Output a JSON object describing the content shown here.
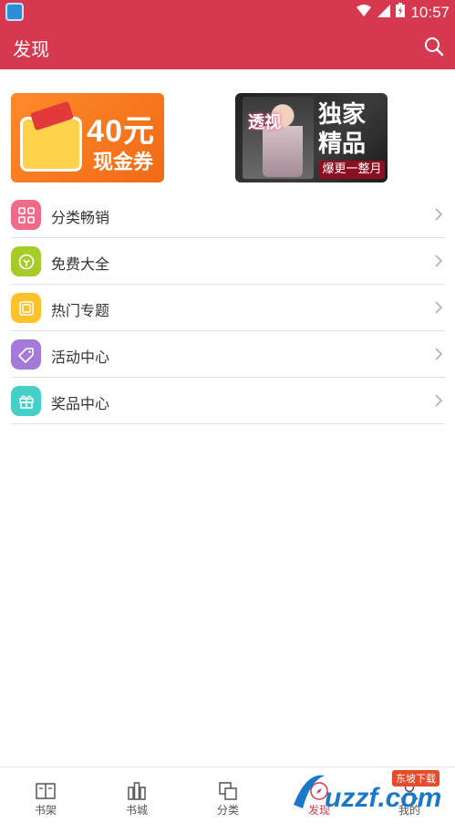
{
  "status_bar": {
    "time": "10:57"
  },
  "app_bar": {
    "title": "发现"
  },
  "banners": {
    "coupon": {
      "amount": "40元",
      "text": "现金券"
    },
    "book": {
      "title": "透视",
      "exclusive": "独家精品",
      "update": "爆更一整月"
    }
  },
  "menu": [
    {
      "label": "分类畅销",
      "color": "#f06b89",
      "icon": "grid-icon"
    },
    {
      "label": "免费大全",
      "color": "#a6cc2a",
      "icon": "free-icon"
    },
    {
      "label": "热门专题",
      "color": "#ffc12c",
      "icon": "topic-icon"
    },
    {
      "label": "活动中心",
      "color": "#a47ad8",
      "icon": "tag-icon"
    },
    {
      "label": "奖品中心",
      "color": "#45cfc9",
      "icon": "gift-icon"
    }
  ],
  "tabs": [
    {
      "label": "书架",
      "icon": "bookshelf-icon"
    },
    {
      "label": "书城",
      "icon": "bookstore-icon"
    },
    {
      "label": "分类",
      "icon": "category-icon"
    },
    {
      "label": "发现",
      "icon": "discover-icon"
    },
    {
      "label": "我的",
      "icon": "profile-icon"
    }
  ],
  "watermark": {
    "brand": "uzzf.com",
    "sub": "东坡下载"
  }
}
